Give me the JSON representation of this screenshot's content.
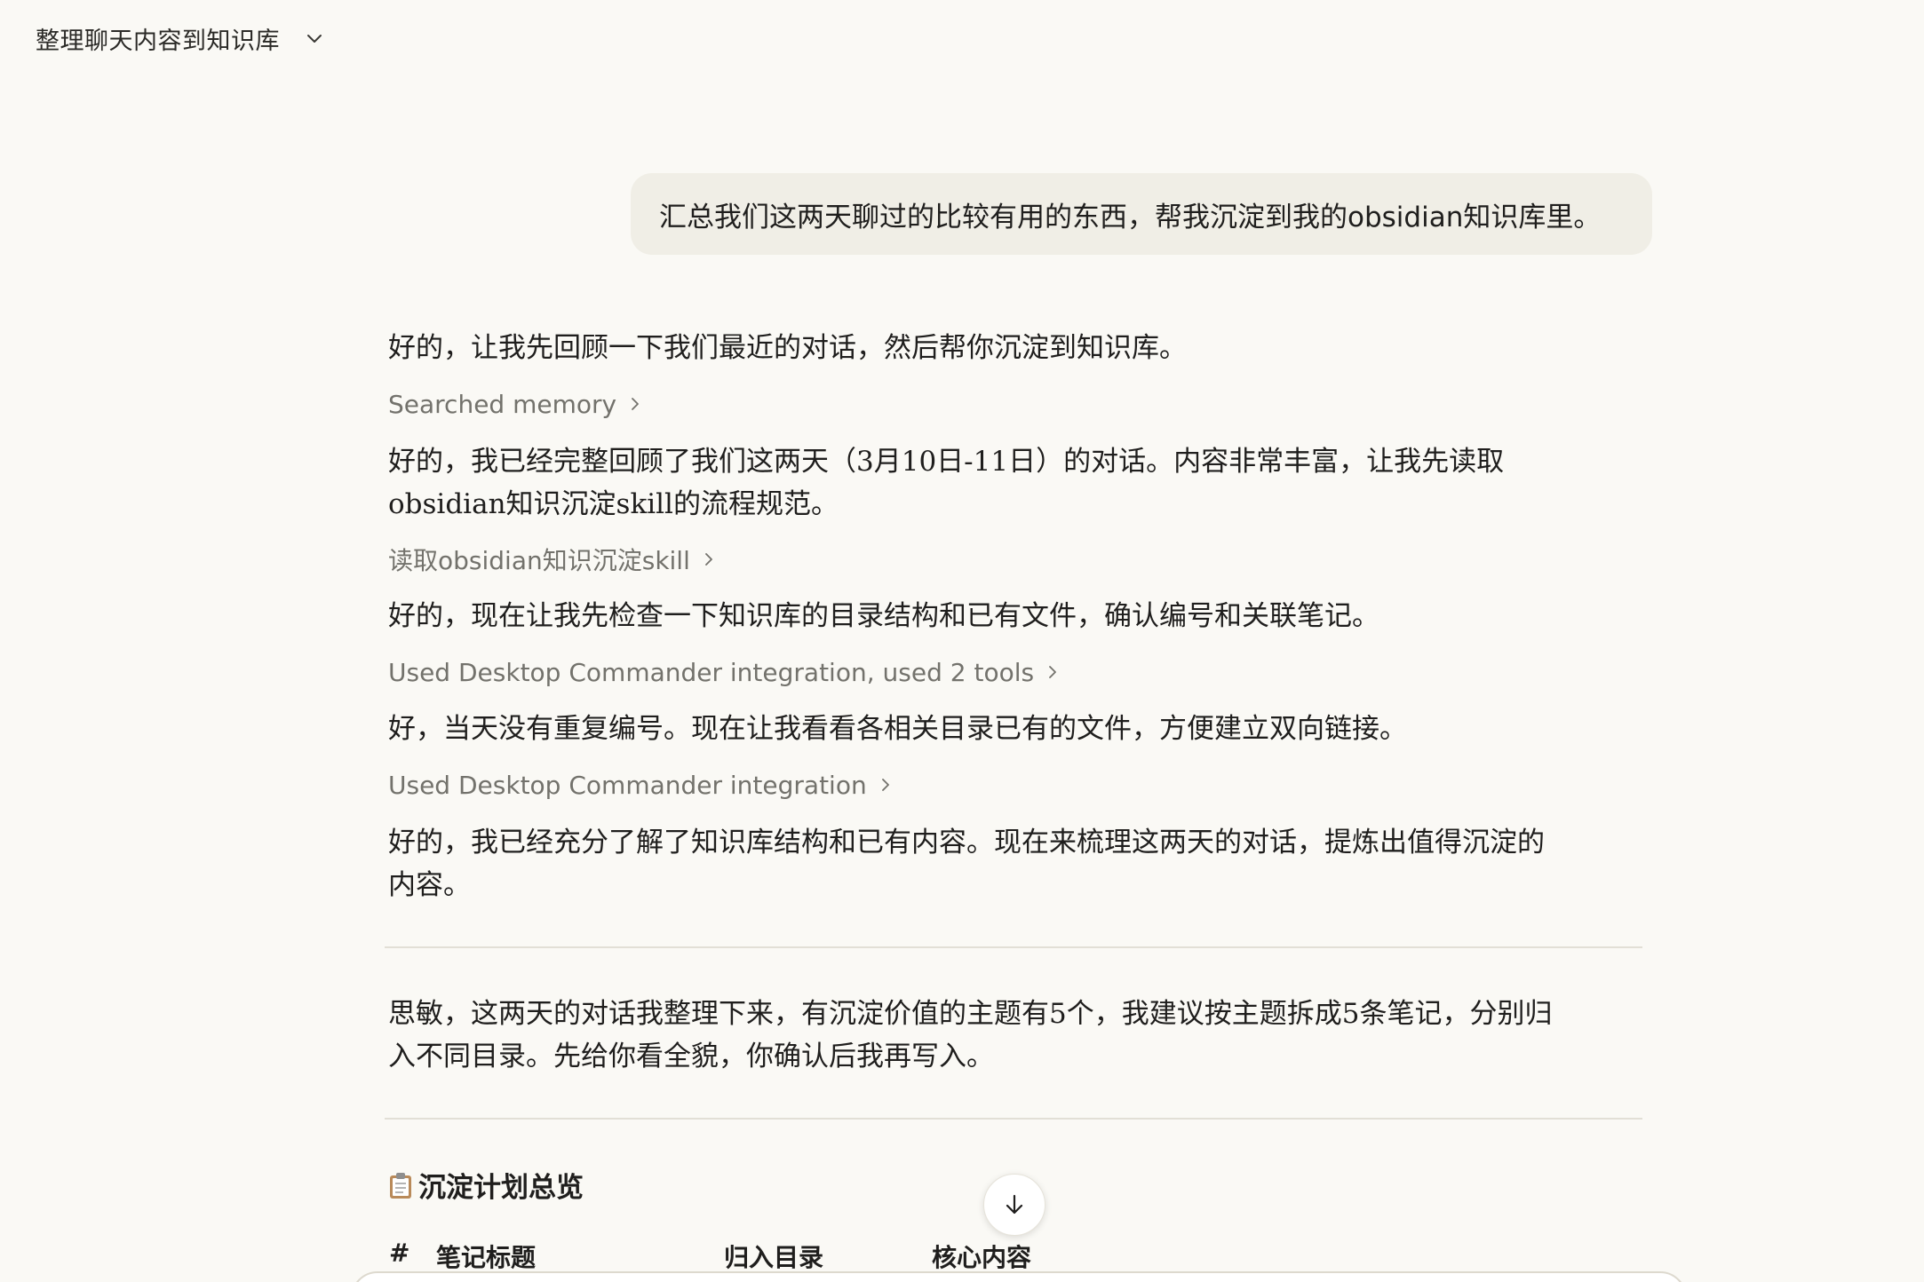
{
  "header": {
    "chat_title": "整理聊天内容到知识库",
    "menu_icon": "chevron-down-icon"
  },
  "user_message": "汇总我们这两天聊过的比较有用的东西，帮我沉淀到我的obsidian知识库里。",
  "assistant": {
    "para1": "好的，让我先回顾一下我们最近的对话，然后帮你沉淀到知识库。",
    "tool1": "Searched memory",
    "para2_line1": "好的，我已经完整回顾了我们这两天（3月10日-11日）的对话。内容非常丰富，让我先读取",
    "para2_line2": "obsidian知识沉淀skill的流程规范。",
    "tool2": "读取obsidian知识沉淀skill",
    "para3": "好的，现在让我先检查一下知识库的目录结构和已有文件，确认编号和关联笔记。",
    "tool3": "Used Desktop Commander integration, used 2 tools",
    "para4": "好，当天没有重复编号。现在让我看看各相关目录已有的文件，方便建立双向链接。",
    "tool4": "Used Desktop Commander integration",
    "para5_line1": "好的，我已经充分了解了知识库结构和已有内容。现在来梳理这两天的对话，提炼出值得沉淀的",
    "para5_line2": "内容。",
    "para6_line1": "思敏，这两天的对话我整理下来，有沉淀价值的主题有5个，我建议按主题拆成5条笔记，分别归",
    "para6_line2": "入不同目录。先给你看全貌，你确认后我再写入。",
    "section_title": "沉淀计划总览",
    "section_icon": "clipboard-icon",
    "table_headers": [
      "#",
      "笔记标题",
      "归入目录",
      "核心内容"
    ]
  },
  "scroll_button_icon": "arrow-down-icon"
}
